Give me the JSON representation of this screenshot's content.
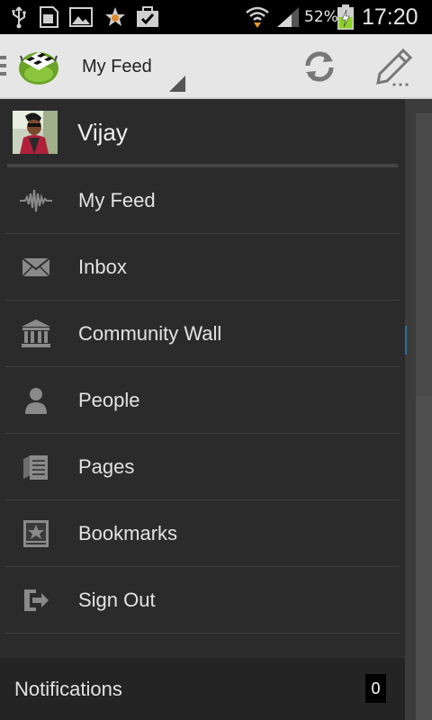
{
  "status_bar": {
    "icons": [
      "usb-icon",
      "sd-card-icon",
      "image-icon",
      "star-notification-icon",
      "task-check-icon",
      "wifi-icon",
      "signal-icon",
      "battery-charging-icon"
    ],
    "battery_percent": "52%",
    "time": "17:20"
  },
  "action_bar": {
    "title": "My Feed",
    "icons": [
      "app-logo-icon",
      "refresh-icon",
      "compose-icon"
    ]
  },
  "profile": {
    "name": "Vijay"
  },
  "menu": {
    "items": [
      {
        "label": "My Feed",
        "icon": "pulse-icon"
      },
      {
        "label": "Inbox",
        "icon": "envelope-icon"
      },
      {
        "label": "Community Wall",
        "icon": "bank-icon"
      },
      {
        "label": "People",
        "icon": "person-icon"
      },
      {
        "label": "Pages",
        "icon": "pages-icon"
      },
      {
        "label": "Bookmarks",
        "icon": "bookmark-icon"
      },
      {
        "label": "Sign Out",
        "icon": "sign-out-icon"
      }
    ]
  },
  "notifications": {
    "label": "Notifications",
    "count": "0"
  },
  "colors": {
    "drawer_bg": "#2b2b2b",
    "action_bar_bg": "#e6e6e6",
    "icon_gray": "#8a8a8a",
    "battery_green": "#8ed12a"
  }
}
